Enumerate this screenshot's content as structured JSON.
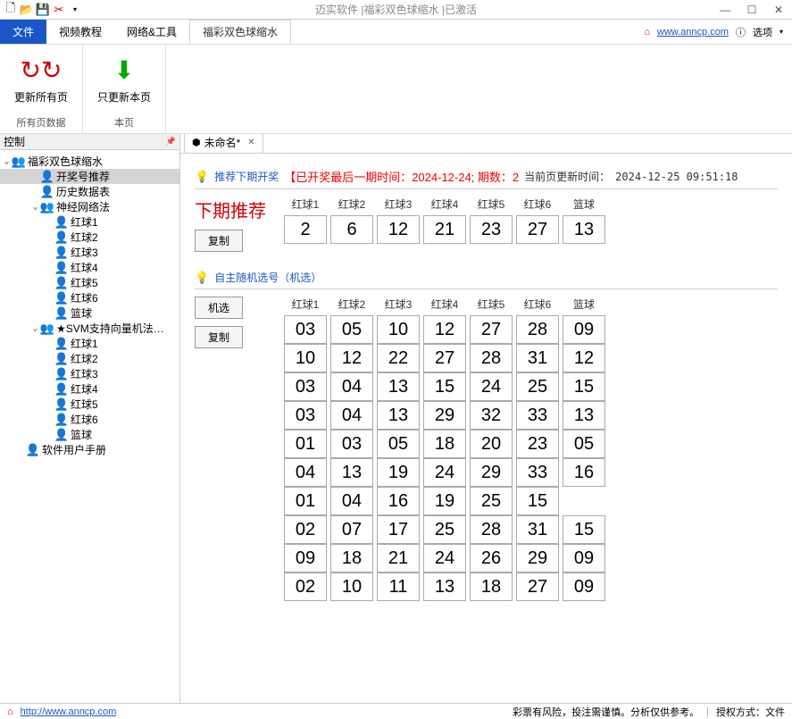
{
  "titlebar": {
    "title": "迈实软件 |福彩双色球缩水 |已激活"
  },
  "menubar": {
    "tabs": [
      "文件",
      "视频教程",
      "网络&工具",
      "福彩双色球缩水"
    ],
    "url": "www.anncp.com",
    "options": "选项"
  },
  "ribbon": {
    "btn1": "更新所有页",
    "btn2": "只更新本页",
    "group1": "所有页数据",
    "group2": "本页"
  },
  "tree": {
    "header": "控制",
    "root": "福彩双色球缩水",
    "items": [
      {
        "label": "开奖号推荐",
        "indent": 2,
        "selected": true
      },
      {
        "label": "历史数据表",
        "indent": 2
      },
      {
        "label": "神经网络法",
        "indent": 2,
        "expandable": true
      },
      {
        "label": "红球1",
        "indent": 3
      },
      {
        "label": "红球2",
        "indent": 3
      },
      {
        "label": "红球3",
        "indent": 3
      },
      {
        "label": "红球4",
        "indent": 3
      },
      {
        "label": "红球5",
        "indent": 3
      },
      {
        "label": "红球6",
        "indent": 3
      },
      {
        "label": "篮球",
        "indent": 3
      },
      {
        "label": "★SVM支持向量机法…",
        "indent": 2,
        "expandable": true
      },
      {
        "label": "红球1",
        "indent": 3
      },
      {
        "label": "红球2",
        "indent": 3
      },
      {
        "label": "红球3",
        "indent": 3
      },
      {
        "label": "红球4",
        "indent": 3
      },
      {
        "label": "红球5",
        "indent": 3
      },
      {
        "label": "红球6",
        "indent": 3
      },
      {
        "label": "篮球",
        "indent": 3
      },
      {
        "label": "软件用户手册",
        "indent": 1
      }
    ]
  },
  "doc": {
    "tab_title": "未命名*"
  },
  "section1": {
    "link": "推荐下期开奖",
    "alert": "【已开奖最后一期时间：2024-12-24; 期数：2",
    "time_label": "当前页更新时间：",
    "time": "2024-12-25 09:51:18",
    "title": "下期推荐",
    "copy": "复制",
    "headers": [
      "红球1",
      "红球2",
      "红球3",
      "红球4",
      "红球5",
      "红球6",
      "篮球"
    ],
    "values": [
      "2",
      "6",
      "12",
      "21",
      "23",
      "27",
      "13"
    ]
  },
  "section2": {
    "link": "自主随机选号（机选）",
    "random": "机选",
    "copy": "复制",
    "headers": [
      "红球1",
      "红球2",
      "红球3",
      "红球4",
      "红球5",
      "红球6",
      "篮球"
    ],
    "rows": [
      [
        "03",
        "05",
        "10",
        "12",
        "27",
        "28",
        "09"
      ],
      [
        "10",
        "12",
        "22",
        "27",
        "28",
        "31",
        "12"
      ],
      [
        "03",
        "04",
        "13",
        "15",
        "24",
        "25",
        "15"
      ],
      [
        "03",
        "04",
        "13",
        "29",
        "32",
        "33",
        "13"
      ],
      [
        "01",
        "03",
        "05",
        "18",
        "20",
        "23",
        "05"
      ],
      [
        "04",
        "13",
        "19",
        "24",
        "29",
        "33",
        "16"
      ],
      [
        "01",
        "04",
        "16",
        "19",
        "25",
        "15",
        ""
      ],
      [
        "02",
        "07",
        "17",
        "25",
        "28",
        "31",
        "15"
      ],
      [
        "09",
        "18",
        "21",
        "24",
        "26",
        "29",
        "09"
      ],
      [
        "02",
        "10",
        "11",
        "13",
        "18",
        "27",
        "09"
      ]
    ]
  },
  "statusbar": {
    "url": "http://www.anncp.com",
    "risk": "彩票有风险，投注需谨慎。分析仅供参考。",
    "auth": "授权方式：文件"
  }
}
